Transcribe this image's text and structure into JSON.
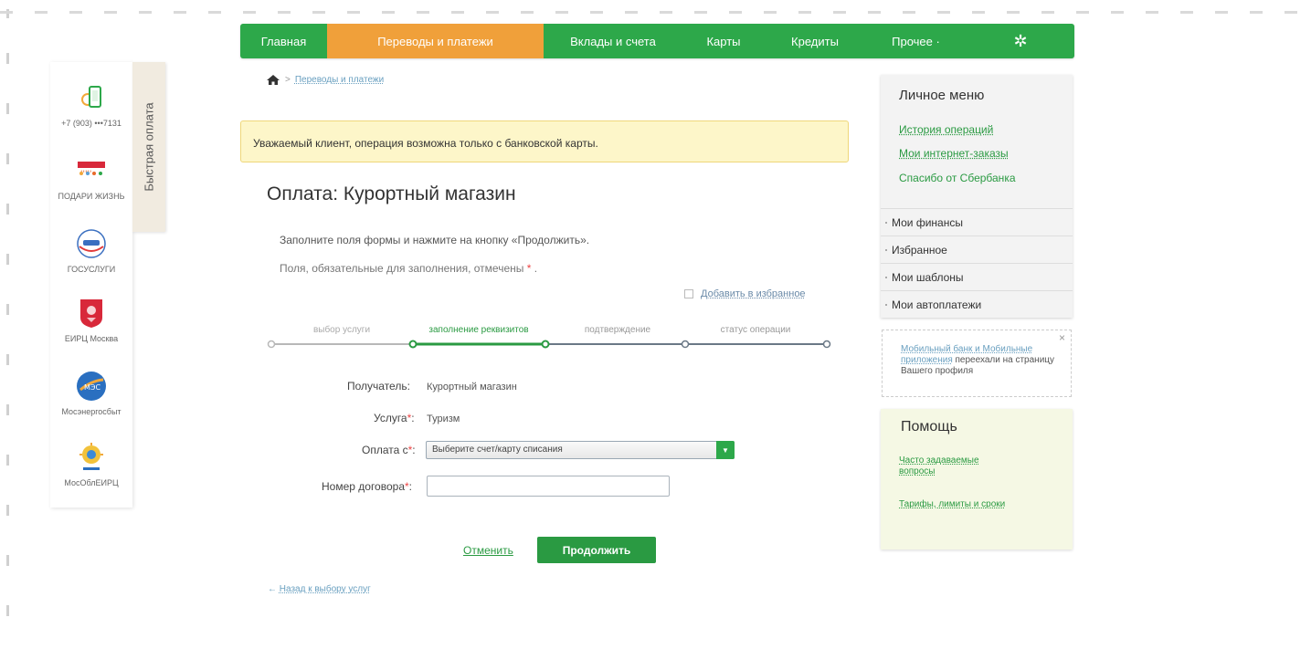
{
  "nav": {
    "items": [
      {
        "label": "Главная",
        "active": false
      },
      {
        "label": "Переводы и платежи",
        "active": true
      },
      {
        "label": "Вклады и счета",
        "active": false
      },
      {
        "label": "Карты",
        "active": false
      },
      {
        "label": "Кредиты",
        "active": false
      },
      {
        "label": "Прочее ·",
        "active": false
      }
    ],
    "gear_icon": "gear-icon",
    "gear_glyph": "✲"
  },
  "quickpay": {
    "tab_label": "Быстрая оплата",
    "items": [
      {
        "label": "+7 (903) •••7131",
        "icon": "mobile-phone-icon"
      },
      {
        "label": "ПОДАРИ ЖИЗНЬ",
        "icon": "podari-zhizn-logo-icon"
      },
      {
        "label": "ГОСУСЛУГИ",
        "icon": "gosuslugi-logo-icon"
      },
      {
        "label": "ЕИРЦ Москва",
        "icon": "moscow-coat-of-arms-icon"
      },
      {
        "label": "Мосэнергосбыт",
        "icon": "mosenergosbyt-logo-icon"
      },
      {
        "label": "МосОблЕИРЦ",
        "icon": "mosobleirc-logo-icon"
      }
    ]
  },
  "breadcrumb": {
    "home_icon": "home-icon",
    "separator": ">",
    "current": "Переводы и платежи"
  },
  "notice": "Уважаемый клиент, операция возможна только с банковской карты.",
  "page_title": "Оплата: Курортный магазин",
  "instruction": "Заполните поля формы и нажмите на кнопку «Продолжить».",
  "required_note": {
    "text": "Поля, обязательные для заполнения, отмечены",
    "star": "*",
    "end": "."
  },
  "favorite": {
    "label": "Добавить в избранное"
  },
  "steps": [
    {
      "label": "выбор услуги",
      "state": "done"
    },
    {
      "label": "заполнение реквизитов",
      "state": "active"
    },
    {
      "label": "подтверждение",
      "state": "pending"
    },
    {
      "label": "статус операции",
      "state": "pending"
    }
  ],
  "form": {
    "recipient_label": "Получатель:",
    "recipient_value": "Курортный магазин",
    "service_label": "Услуга",
    "service_value": "Туризм",
    "payfrom_label": "Оплата с",
    "payfrom_value": "Выберите счет/карту списания",
    "contract_label": "Номер договора",
    "contract_value": "",
    "star": "*",
    "colon": ":"
  },
  "actions": {
    "cancel": "Отменить",
    "continue": "Продолжить",
    "back_arrow": "←",
    "back": "Назад к выбору услуг"
  },
  "personal_menu": {
    "title": "Личное меню",
    "links": [
      "История операций",
      "Мои интернет-заказы",
      "Спасибо от Сбербанка"
    ],
    "items": [
      "Мои финансы",
      "Избранное",
      "Мои шаблоны",
      "Мои автоплатежи"
    ]
  },
  "mobile_notice": {
    "link1": "Мобильный банк и Мобильные",
    "link2": "приложения",
    "text": "переехали на страницу Вашего профиля",
    "close": "×"
  },
  "help": {
    "title": "Помощь",
    "links": [
      "Часто задаваемые вопросы",
      "Тарифы, лимиты и сроки"
    ]
  },
  "colors": {
    "brand_green": "#2da84a",
    "active_orange": "#f0a03a",
    "notice_bg": "#fdf6c9"
  }
}
